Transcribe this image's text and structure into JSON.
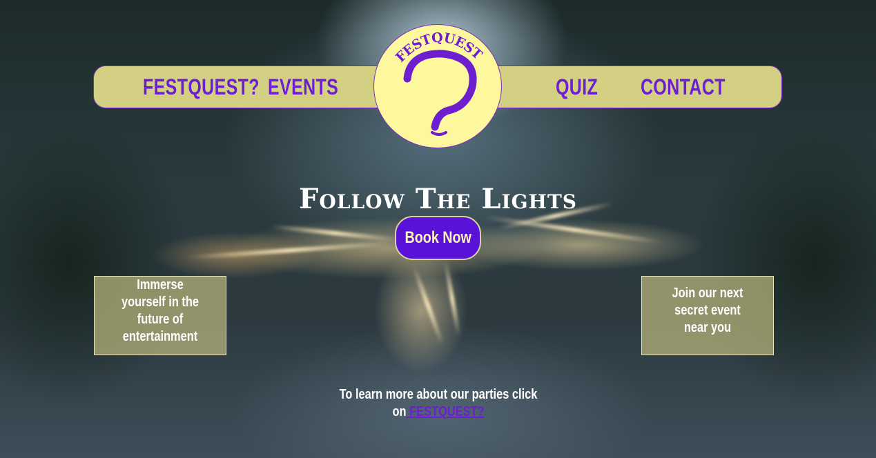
{
  "nav": {
    "links": [
      {
        "label": "FESTQUEST?"
      },
      {
        "label": "EVENTS"
      },
      {
        "label": "QUIZ"
      },
      {
        "label": "CONTACT"
      }
    ],
    "logo": {
      "text": "FESTQUEST",
      "icon": "question-mark-icon"
    }
  },
  "hero": {
    "title": "Follow The Lights",
    "button_label": "Book Now"
  },
  "boxes": {
    "left": "Immerse yourself in the future of entertainment",
    "right": "Join our next secret event near you"
  },
  "footer": {
    "text": "To learn more about our parties click on",
    "link_label": " FESTQUEST?"
  },
  "colors": {
    "accent": "#6d1fd0",
    "nav_bg": "#d3d083",
    "logo_bg": "#fdf79d",
    "button_bg": "#5a11d8"
  }
}
